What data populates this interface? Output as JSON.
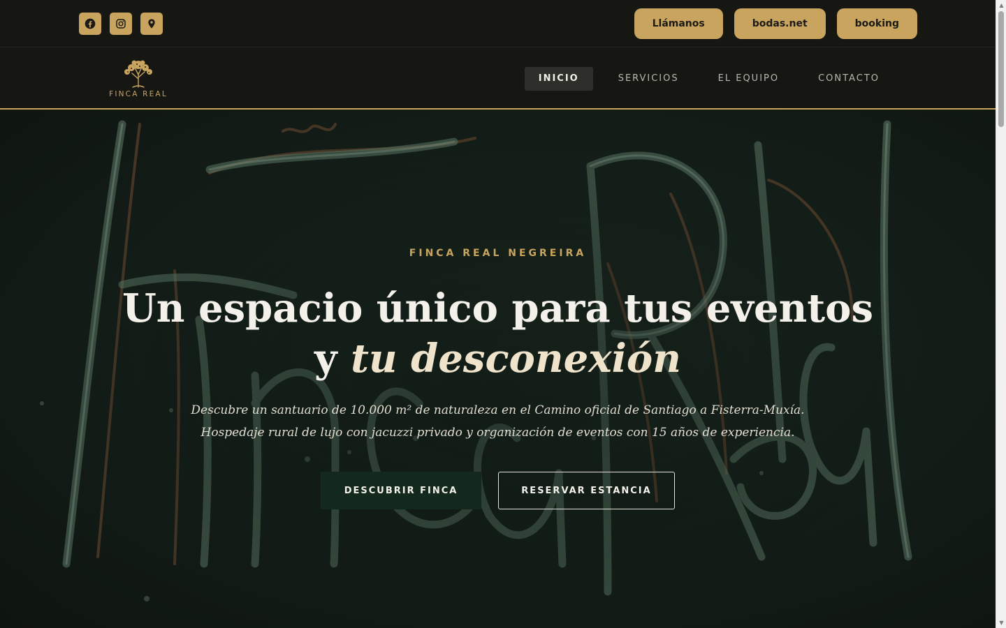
{
  "topbar": {
    "social": [
      {
        "icon": "facebook-icon"
      },
      {
        "icon": "instagram-icon"
      },
      {
        "icon": "map-pin-icon"
      }
    ],
    "actions": [
      "Llámanos",
      "bodas.net",
      "booking"
    ]
  },
  "brand": {
    "logo_text": "FINCA REAL",
    "logo_icon": "tree-icon"
  },
  "nav": {
    "items": [
      "INICIO",
      "SERVICIOS",
      "EL EQUIPO",
      "CONTACTO"
    ],
    "active": "INICIO"
  },
  "hero": {
    "eyebrow": "FINCA REAL NEGREIRA",
    "headline_line1": "Un espacio único para tus eventos",
    "headline_line2_plain": "y",
    "headline_line2_em": "tu desconexión",
    "lead": "Descubre un santuario de 10.000 m² de naturaleza en el Camino oficial de Santiago a Fisterra-Muxía. Hospedaje rural de lujo con jacuzzi privado y organización de eventos con 15 años de experiencia.",
    "cta_primary": "DESCUBRIR FINCA",
    "cta_secondary": "RESERVAR ESTANCIA",
    "background_sign_text": "FincaReal"
  },
  "colors": {
    "gold": "#c9a45f",
    "dark": "#161713",
    "hero_green": "#14291e"
  }
}
